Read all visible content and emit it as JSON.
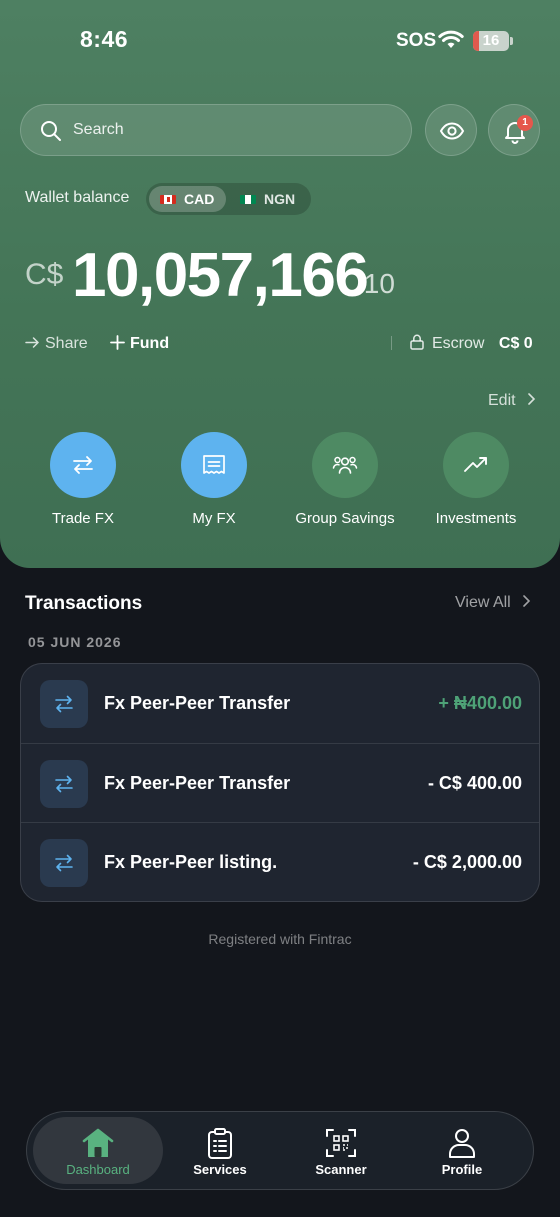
{
  "status_bar": {
    "time": "8:46",
    "sos": "SOS",
    "battery": "16",
    "battery_level": 0.16
  },
  "header": {
    "search_placeholder": "Search",
    "notification_count": "1"
  },
  "wallet": {
    "label": "Wallet balance",
    "currencies": [
      "CAD",
      "NGN"
    ],
    "selected_currency": "CAD",
    "currency_symbol": "C$",
    "amount_whole": "10,057,166",
    "amount_decimal": ".10",
    "share_label": "Share",
    "fund_label": "Fund",
    "escrow_label": "Escrow",
    "escrow_value": "C$ 0"
  },
  "quick_actions": {
    "edit_label": "Edit",
    "items": [
      {
        "label": "Trade FX",
        "icon": "swap-arrows-icon",
        "color": "#5eb3ef"
      },
      {
        "label": "My FX",
        "icon": "receipt-icon",
        "color": "#5eb3ef"
      },
      {
        "label": "Group Savings",
        "icon": "group-icon",
        "color": "#4e8a63"
      },
      {
        "label": "Investments",
        "icon": "trend-up-icon",
        "color": "#4e8a63"
      }
    ]
  },
  "transactions": {
    "title": "Transactions",
    "view_all": "View All",
    "date": "05 JUN 2026",
    "items": [
      {
        "name": "Fx Peer-Peer Transfer",
        "amount": "+ ₦400.00",
        "positive": true
      },
      {
        "name": "Fx Peer-Peer Transfer",
        "amount": "- C$ 400.00",
        "positive": false
      },
      {
        "name": "Fx Peer-Peer listing.",
        "amount": "- C$ 2,000.00",
        "positive": false
      }
    ]
  },
  "footer_note": "Registered with Fintrac",
  "bottom_nav": {
    "items": [
      {
        "label": "Dashboard",
        "icon": "home-icon",
        "active": true
      },
      {
        "label": "Services",
        "icon": "clipboard-icon",
        "active": false
      },
      {
        "label": "Scanner",
        "icon": "qr-scan-icon",
        "active": false
      },
      {
        "label": "Profile",
        "icon": "person-icon",
        "active": false
      }
    ]
  },
  "colors": {
    "hero_green": "#4e8062",
    "accent_blue": "#5eb3ef",
    "positive_green": "#4ea277",
    "badge_red": "#e5574c",
    "background": "#13161c"
  }
}
